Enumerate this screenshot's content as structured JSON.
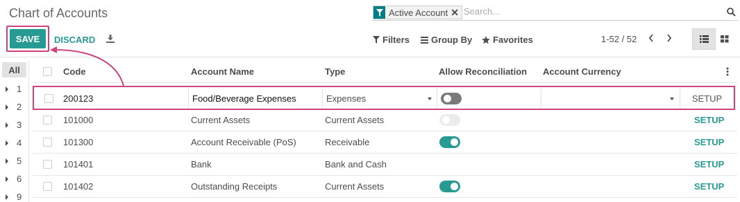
{
  "page": {
    "title": "Chart of Accounts"
  },
  "search": {
    "facet_label": "Active Account",
    "placeholder": "Search..."
  },
  "toolbar": {
    "save_label": "SAVE",
    "discard_label": "DISCARD",
    "filters_label": "Filters",
    "groupby_label": "Group By",
    "favorites_label": "Favorites",
    "pager_value": "1-52 / 52"
  },
  "side": {
    "all_label": "All",
    "items": [
      "1",
      "2",
      "3",
      "4",
      "5",
      "6",
      "9"
    ]
  },
  "table": {
    "headers": {
      "code": "Code",
      "name": "Account Name",
      "type": "Type",
      "reconcile": "Allow Reconciliation",
      "currency": "Account Currency"
    },
    "edit_row": {
      "code": "200123",
      "name": "Food/Beverage Expenses",
      "type": "Expenses",
      "reconcile": "off",
      "currency": "",
      "action": "SETUP"
    },
    "rows": [
      {
        "code": "101000",
        "name": "Current Assets",
        "type": "Current Assets",
        "reconcile": "off-disabled",
        "action": "SETUP"
      },
      {
        "code": "101300",
        "name": "Account Receivable (PoS)",
        "type": "Receivable",
        "reconcile": "on",
        "action": "SETUP"
      },
      {
        "code": "101401",
        "name": "Bank",
        "type": "Bank and Cash",
        "reconcile": "none",
        "action": "SETUP"
      },
      {
        "code": "101402",
        "name": "Outstanding Receipts",
        "type": "Current Assets",
        "reconcile": "on",
        "action": "SETUP"
      }
    ]
  },
  "colors": {
    "accent": "#279a94",
    "highlight": "#d0417f",
    "facet_icon": "#017e84"
  }
}
